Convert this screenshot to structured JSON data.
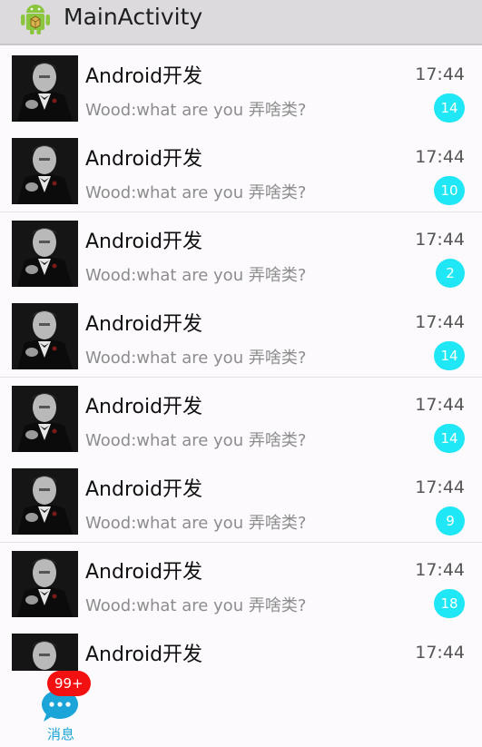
{
  "appbar": {
    "title": "MainActivity",
    "icon": "android-robot-icon"
  },
  "conversations": [
    {
      "name": "Android开发",
      "time": "17:44",
      "message": "Wood:what are you 弄啥类?",
      "unread": "14"
    },
    {
      "name": "Android开发",
      "time": "17:44",
      "message": "Wood:what are you 弄啥类?",
      "unread": "10"
    },
    {
      "name": "Android开发",
      "time": "17:44",
      "message": "Wood:what are you 弄啥类?",
      "unread": "2"
    },
    {
      "name": "Android开发",
      "time": "17:44",
      "message": "Wood:what are you 弄啥类?",
      "unread": "14"
    },
    {
      "name": "Android开发",
      "time": "17:44",
      "message": "Wood:what are you 弄啥类?",
      "unread": "14"
    },
    {
      "name": "Android开发",
      "time": "17:44",
      "message": "Wood:what are you 弄啥类?",
      "unread": "9"
    },
    {
      "name": "Android开发",
      "time": "17:44",
      "message": "Wood:what are you 弄啥类?",
      "unread": "18"
    },
    {
      "name": "Android开发",
      "time": "17:44",
      "message": "",
      "unread": ""
    }
  ],
  "bottom_tab": {
    "label": "消息",
    "badge": "99+",
    "icon": "chat-bubble-icon"
  },
  "colors": {
    "badge": "#1fe7f6",
    "tab_badge": "#f21010",
    "tab_accent": "#1aa4d8",
    "appbar": "#dcdadd"
  }
}
